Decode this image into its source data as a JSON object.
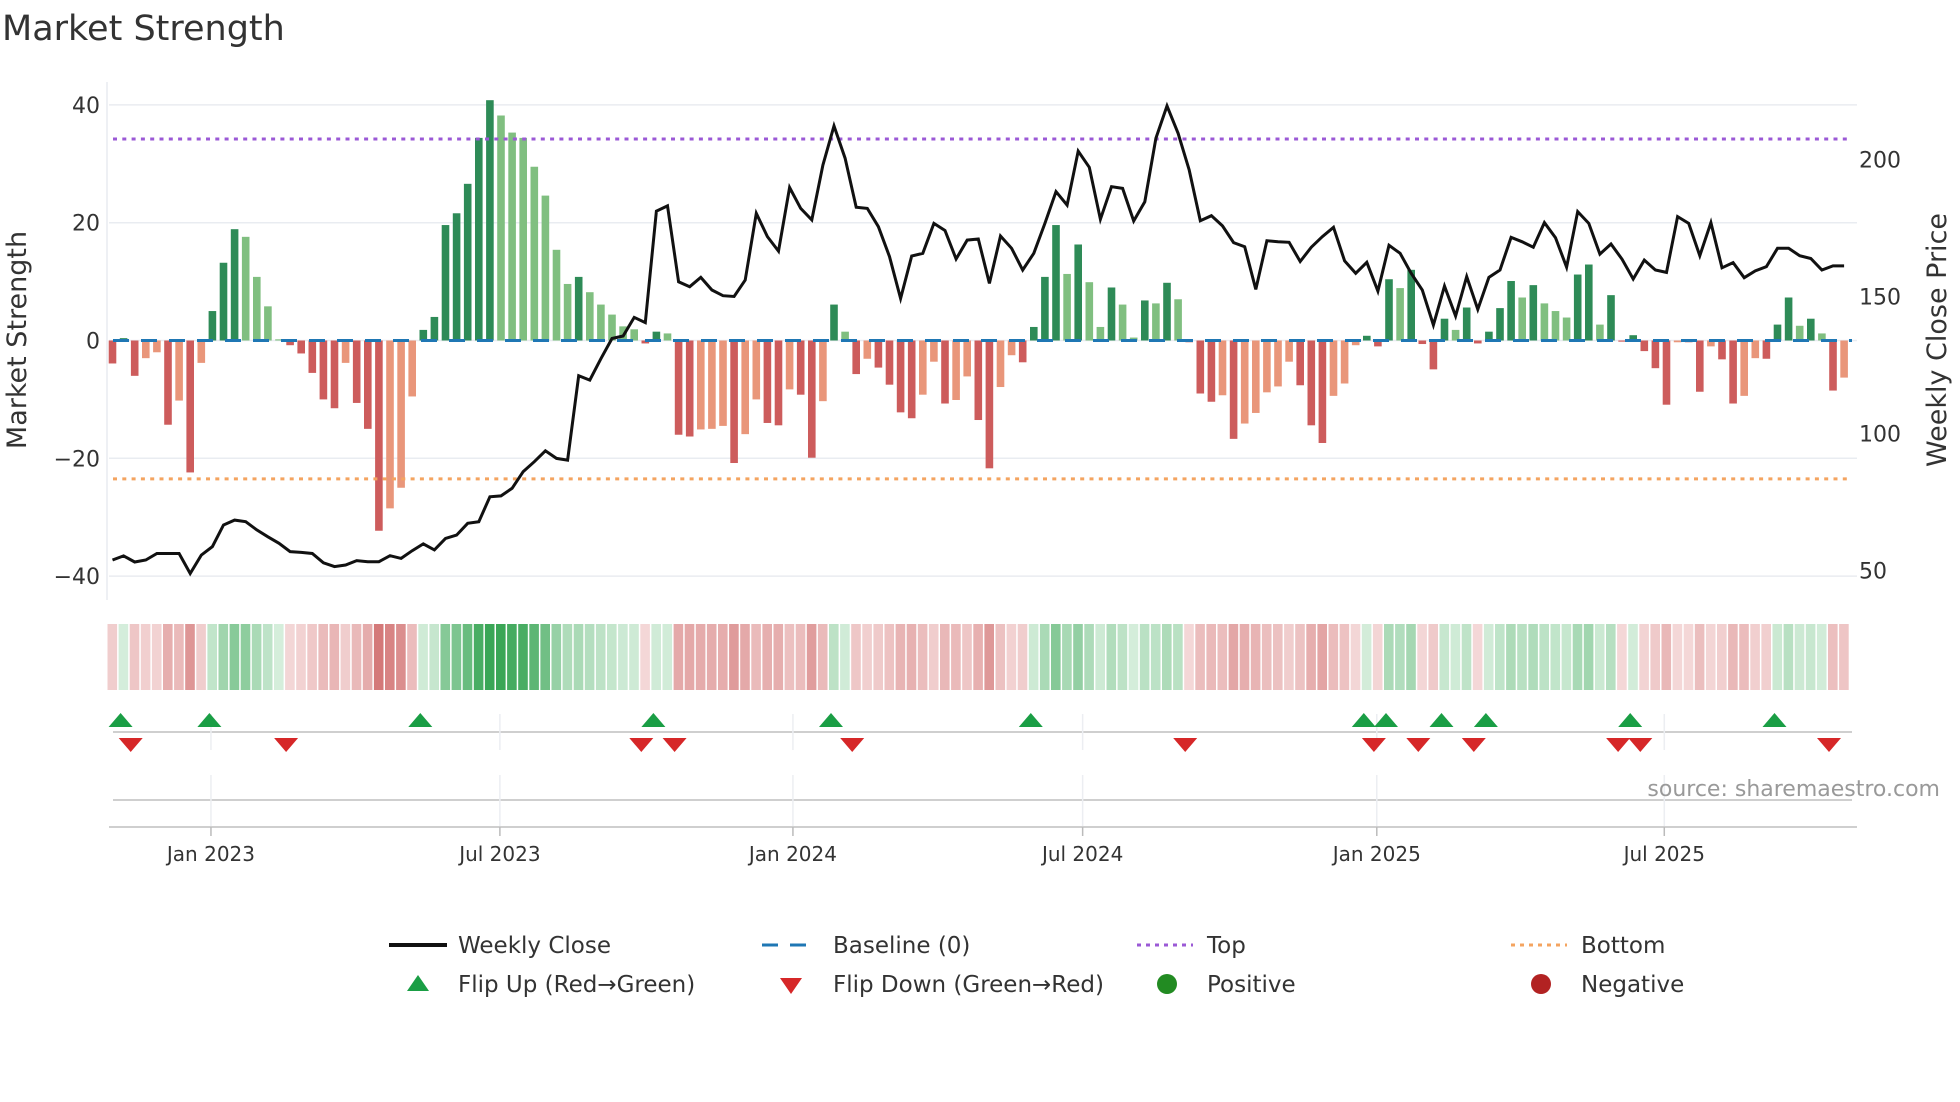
{
  "title": "Market Strength",
  "source": "source: sharemaestro.com",
  "colors": {
    "pos_dark": "#2e8b57",
    "pos_light": "#80bf80",
    "neg_dark": "#cd5c5c",
    "neg_light": "#e9967a",
    "baseline": "#1f77b4",
    "top": "#9b59d6",
    "bottom": "#f4a460",
    "close": "#111111",
    "flip_up": "#1a9e45",
    "flip_down": "#d62728",
    "positive": "#228b22",
    "negative": "#b22222"
  },
  "chart_data": {
    "type": "bar",
    "title": "Market Strength",
    "ylabel": "Market Strength",
    "y2label": "Weekly Close Price",
    "ylim": [
      -44,
      44
    ],
    "y2lim": [
      48,
      226
    ],
    "yticks": [
      40,
      20,
      0,
      -20,
      -40
    ],
    "ytick_labels": [
      "40",
      "20",
      "0",
      "−20",
      "−40"
    ],
    "y2ticks": [
      200,
      150,
      100,
      50
    ],
    "y2tick_labels": [
      "200",
      "150",
      "100",
      "50"
    ],
    "xticks": [
      {
        "label": "Jan 2023",
        "week": 8.87
      },
      {
        "label": "Jul 2023",
        "week": 34.9
      },
      {
        "label": "Jan 2024",
        "week": 61.3
      },
      {
        "label": "Jul 2024",
        "week": 87.4
      },
      {
        "label": "Jan 2025",
        "week": 113.9
      },
      {
        "label": "Jul 2025",
        "week": 139.8
      }
    ],
    "top_level": 34.2,
    "bottom_level": -23.5,
    "baseline": 0,
    "strength": [
      -3.9,
      0.4,
      -6,
      -3,
      -2,
      -14.3,
      -10.2,
      -22.4,
      -3.8,
      5,
      13.2,
      18.9,
      17.6,
      10.8,
      5.8,
      0.2,
      -0.8,
      -2.2,
      -5.5,
      -10,
      -11.5,
      -3.8,
      -10.6,
      -15,
      -32.3,
      -28.5,
      -25,
      -9.5,
      1.8,
      4,
      19.6,
      21.6,
      26.6,
      34.4,
      40.8,
      38.2,
      35.3,
      34.4,
      29.5,
      24.6,
      15.4,
      9.6,
      10.8,
      8.2,
      6.1,
      4.4,
      2.4,
      1.9,
      -0.5,
      1.5,
      1.2,
      -16,
      -16.3,
      -15.1,
      -15,
      -14.5,
      -20.8,
      -15.9,
      -10,
      -14,
      -14.4,
      -8.3,
      -9.2,
      -19.9,
      -10.3,
      6.1,
      1.5,
      -5.7,
      -3.1,
      -4.6,
      -7.5,
      -12.2,
      -13.2,
      -9.2,
      -3.6,
      -10.7,
      -10.1,
      -6.1,
      -13.5,
      -21.7,
      -7.9,
      -2.5,
      -3.7,
      2.3,
      10.8,
      19.6,
      11.3,
      16.3,
      9.9,
      2.3,
      9,
      6.1,
      0.5,
      6.8,
      6.3,
      9.8,
      7,
      -0.3,
      -9,
      -10.4,
      -9.3,
      -16.7,
      -14.1,
      -12.3,
      -8.8,
      -7.8,
      -3.6,
      -7.6,
      -14.4,
      -17.4,
      -9.4,
      -7.3,
      -0.8,
      0.8,
      -1,
      10.4,
      8.9,
      12,
      -0.6,
      -4.9,
      3.7,
      1.8,
      5.6,
      -0.5,
      1.5,
      5.5,
      10.1,
      7.3,
      9.4,
      6.3,
      5,
      3.9,
      11.2,
      12.9,
      2.7,
      7.7,
      -0.2,
      0.9,
      -1.8,
      -4.7,
      -10.9,
      -0.3,
      -0.3,
      -8.7,
      -1,
      -3.2,
      -10.7,
      -9.4,
      -3,
      -3.1,
      2.7,
      7.3,
      2.5,
      3.7,
      1.2,
      -8.5,
      -6.3
    ],
    "weekly_close": [
      53.8,
      55.3,
      53.1,
      53.8,
      56.2,
      56.2,
      56.2,
      48.9,
      55.6,
      58.7,
      66.6,
      68.4,
      67.8,
      64.8,
      62.3,
      59.9,
      56.9,
      56.6,
      56.2,
      52.8,
      51.4,
      52.0,
      53.6,
      53.2,
      53.2,
      55.4,
      54.4,
      57.2,
      59.7,
      57.5,
      61.7,
      62.9,
      67.2,
      67.8,
      76.9,
      77.2,
      80.0,
      86.1,
      89.7,
      93.7,
      90.9,
      90.3,
      121.1,
      119.5,
      127.3,
      134.7,
      135.6,
      142.4,
      140.5,
      181.2,
      183.1,
      155.4,
      153.6,
      157.0,
      152.4,
      150.3,
      150.0,
      156.0,
      180.4,
      171.9,
      166.6,
      189.8,
      182.2,
      178.0,
      198.0,
      212.3,
      200.5,
      182.6,
      182.2,
      175.5,
      164.6,
      149.3,
      164.8,
      165.8,
      176.7,
      174.1,
      163.7,
      170.6,
      171.0,
      154.8,
      172.1,
      167.6,
      159.7,
      165.8,
      176.7,
      188.3,
      183.4,
      203.1,
      197.2,
      178.2,
      190.1,
      189.5,
      177.6,
      184.6,
      207.8,
      219.6,
      209.6,
      196.2,
      177.7,
      179.5,
      175.8,
      169.7,
      168.2,
      152.6,
      170.4,
      170.0,
      169.8,
      162.8,
      168.0,
      171.9,
      175.3,
      163.0,
      158.5,
      162.5,
      152.0,
      168.7,
      165.8,
      158.5,
      152.4,
      139.6,
      153.8,
      142.9,
      157.3,
      145.3,
      157.0,
      159.7,
      171.6,
      170.0,
      168.0,
      177.0,
      171.5,
      160.7,
      181.0,
      176.7,
      165.5,
      169.2,
      163.6,
      156.4,
      163.3,
      159.7,
      158.8,
      179.2,
      176.7,
      164.9,
      177.0,
      160.5,
      162.4,
      156.9,
      159.4,
      160.9,
      167.6,
      167.6,
      164.9,
      163.9,
      159.7,
      161.2,
      161.2
    ],
    "flip_up_weeks": [
      1,
      9,
      28,
      49,
      65,
      83,
      113,
      115,
      120,
      124,
      137,
      150
    ],
    "flip_down_weeks": [
      2,
      16,
      48,
      51,
      67,
      97,
      114,
      118,
      123,
      136,
      138,
      155
    ],
    "legend": {
      "placement": "bottom",
      "weekly_close": "Weekly Close",
      "baseline": "Baseline (0)",
      "top": "Top",
      "bottom": "Bottom",
      "flip_up": "Flip Up (Red→Green)",
      "flip_down": "Flip Down (Green→Red)",
      "positive": "Positive",
      "negative": "Negative"
    }
  }
}
